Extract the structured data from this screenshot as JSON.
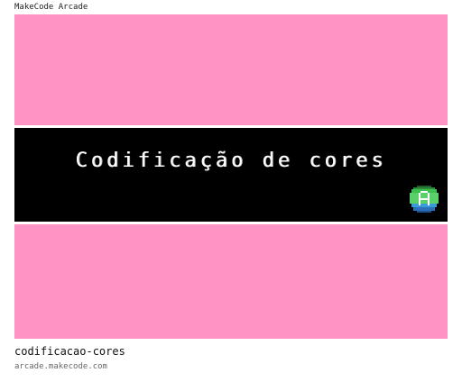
{
  "site": {
    "name": "MakeCode Arcade"
  },
  "card": {
    "banner_text": "Codificação de cores",
    "title": "codificacao-cores",
    "url": "arcade.makecode.com",
    "background_color": "#ff93c4",
    "banner_color": "#000000"
  },
  "icons": {
    "badge": "a-button-icon"
  }
}
